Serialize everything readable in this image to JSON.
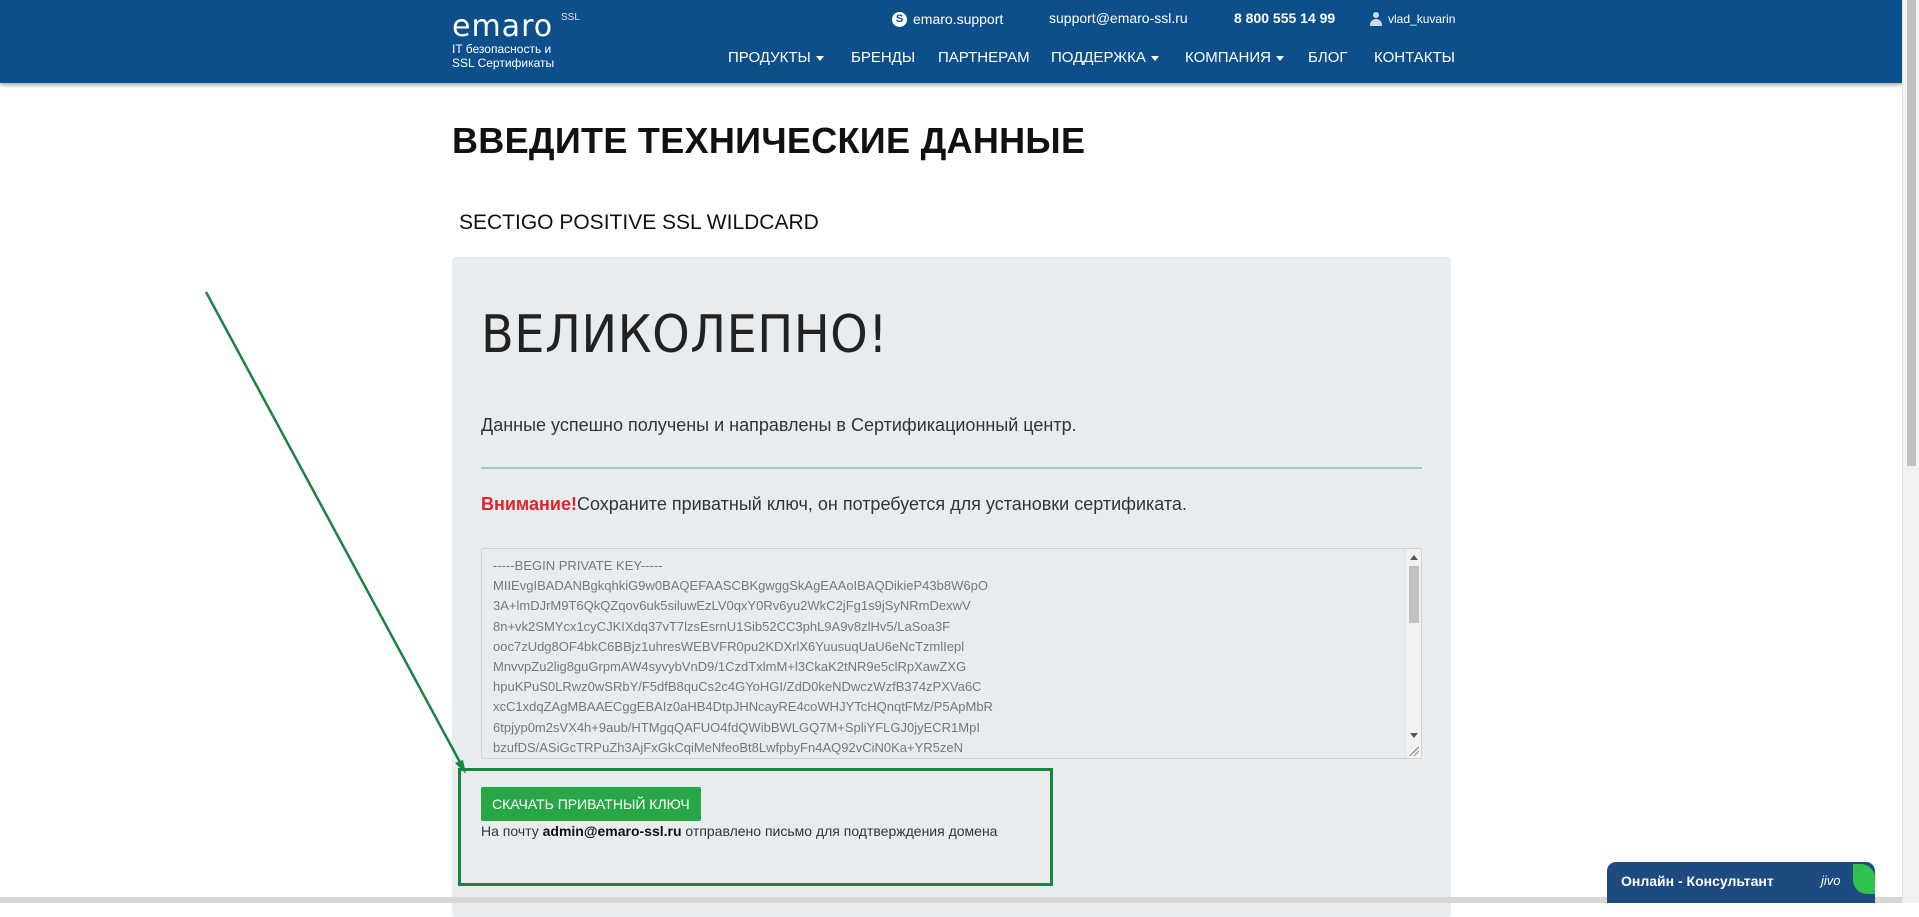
{
  "header": {
    "logo": {
      "word": "emaro",
      "badge": "SSL",
      "tagline_1": "IT безопасность и",
      "tagline_2": "SSL Сертификаты"
    },
    "skype": "emaro.support",
    "email": "support@emaro-ssl.ru",
    "phone": "8 800 555 14 99",
    "user": "vlad_kuvarin",
    "nav": [
      {
        "label": "ПРОДУКТЫ",
        "dropdown": true
      },
      {
        "label": "БРЕНДЫ",
        "dropdown": false
      },
      {
        "label": "ПАРТНЕРАМ",
        "dropdown": false
      },
      {
        "label": "ПОДДЕРЖКА",
        "dropdown": true
      },
      {
        "label": "КОМПАНИЯ",
        "dropdown": true
      },
      {
        "label": "БЛОГ",
        "dropdown": false
      },
      {
        "label": "КОНТАКТЫ",
        "dropdown": false
      }
    ]
  },
  "page": {
    "title": "ВВЕДИТЕ ТЕХНИЧЕСКИЕ ДАННЫЕ",
    "product": "SECTIGO POSITIVE SSL WILDCARD"
  },
  "panel": {
    "heading": "ВЕЛИКОЛЕПНО!",
    "lead": "Данные успешно получены и направлены в Сертификационный центр.",
    "warning_label": "Внимание!",
    "warning_text": "Сохраните приватный ключ, он потребуется для установки сертификата.",
    "private_key": "-----BEGIN PRIVATE KEY-----\nMIIEvgIBADANBgkqhkiG9w0BAQEFAASCBKgwggSkAgEAAoIBAQDikieP43b8W6pO\n3A+lmDJrM9T6QkQZqov6uk5siluwEzLV0qxY0Rv6yu2WkC2jFg1s9jSyNRmDexwV\n8n+vk2SMYcx1cyCJKIXdq37vT7lzsEsrnU1Sib52CC3phL9A9v8zlHv5/LaSoa3F\nooc7zUdg8OF4bkC6BBjz1uhresWEBVFR0pu2KDXrlX6YuusuqUaU6eNcTzmlIepl\nMnvvpZu2lig8guGrpmAW4syvybVnD9/1CzdTxlmM+l3CkaK2tNR9e5clRpXawZXG\nhpuKPuS0LRwz0wSRbY/F5dfB8quCs2c4GYoHGI/ZdD0keNDwczWzfB374zPXVa6C\nxcC1xdqZAgMBAAECggEBAIz0aHB4DtpJHNcayRE4coWHJYTcHQnqtFMz/P5ApMbR\n6tpjyp0m2sVX4h+9aub/HTMgqQAFUO4fdQWibBWLGQ7M+SpliYFLGJ0jyECR1MpI\nbzufDS/ASiGcTRPuZh3AjFxGkCqiMeNfeoBt8LwfpbyFn4AQ92vCiN0Ka+YR5zeN",
    "download_button": "СКАЧАТЬ ПРИВАТНЫЙ КЛЮЧ",
    "mail_prefix": "На почту",
    "mail_address": "admin@emaro-ssl.ru",
    "mail_suffix": "отправлено письмо для подтверждения домена"
  },
  "chat": {
    "label": "Онлайн - Консультант",
    "brand": "jivo"
  },
  "colors": {
    "header_bg": "#0d4f8b",
    "panel_bg": "#e9ecef",
    "button_green": "#27a745",
    "warning_red": "#d9262e",
    "annotation_green": "#17843f",
    "chat_bg": "#1d4a80"
  }
}
